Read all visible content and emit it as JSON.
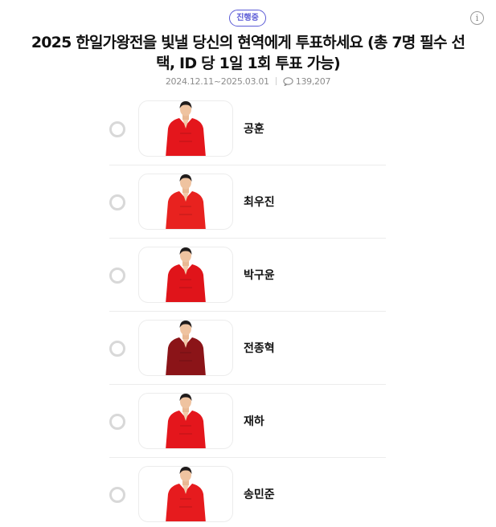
{
  "status_badge": "진행중",
  "info_icon": "info-icon",
  "title": "2025 한일가왕전을 빛낼 당신의 현역에게 투표하세요 (총 7명 필수 선택, ID 당 1일 1회 투표 가능)",
  "period": "2024.12.11~2025.03.01",
  "comment_count": "139,207",
  "colors": {
    "accent": "#5b5bd6",
    "outfit_red": "#e4161c",
    "outfit_dark_red": "#8b1418"
  },
  "candidates": [
    {
      "name": "공훈",
      "outfit": "#e4161c"
    },
    {
      "name": "최우진",
      "outfit": "#e8221f"
    },
    {
      "name": "박구윤",
      "outfit": "#e0141a"
    },
    {
      "name": "전종혁",
      "outfit": "#8b1418"
    },
    {
      "name": "재하",
      "outfit": "#e4161c"
    },
    {
      "name": "송민준",
      "outfit": "#e61b1e"
    }
  ]
}
